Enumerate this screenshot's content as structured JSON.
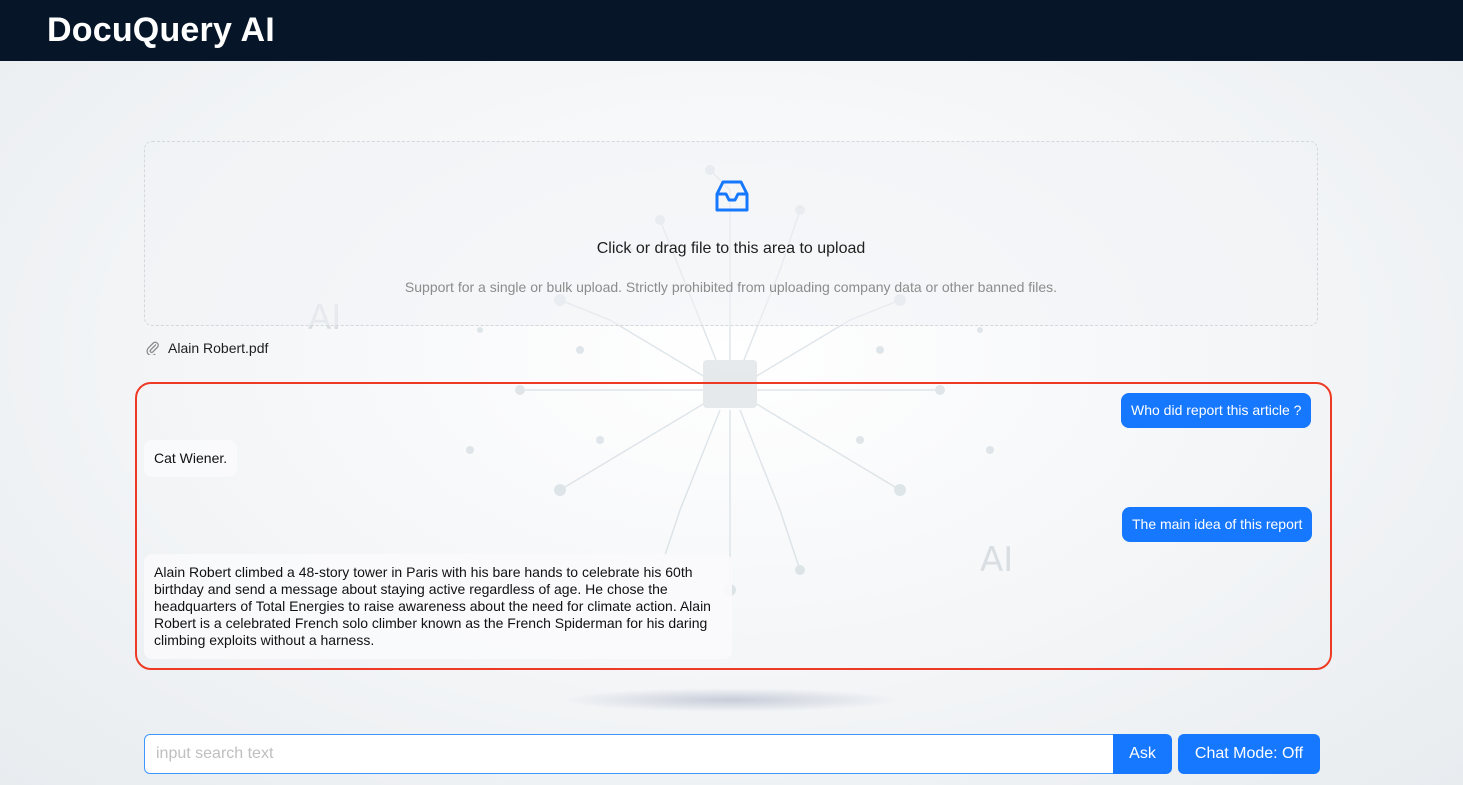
{
  "header": {
    "title": "DocuQuery AI"
  },
  "upload": {
    "icon": "inbox-icon",
    "text": "Click or drag file to this area to upload",
    "hint": "Support for a single or bulk upload. Strictly prohibited from uploading company data or other banned files."
  },
  "file": {
    "icon": "paperclip-icon",
    "name": "Alain Robert.pdf"
  },
  "chat": {
    "messages": [
      {
        "role": "user",
        "text": "Who did report this article ?"
      },
      {
        "role": "bot",
        "text": "Cat Wiener."
      },
      {
        "role": "user",
        "text": "The main idea of this report"
      },
      {
        "role": "bot",
        "text": "Alain Robert climbed a 48-story tower in Paris with his bare hands to celebrate his 60th birthday and send a message about staying active regardless of age. He chose the headquarters of Total Energies to raise awareness about the need for climate action. Alain Robert is a celebrated French solo climber known as the French Spiderman for his daring climbing exploits without a harness."
      }
    ]
  },
  "search": {
    "placeholder": "input search text",
    "ask_label": "Ask",
    "mode_label": "Chat Mode: Off"
  },
  "colors": {
    "header_bg": "#061528",
    "accent": "#1677ff",
    "highlight_border": "#ee3a24"
  }
}
